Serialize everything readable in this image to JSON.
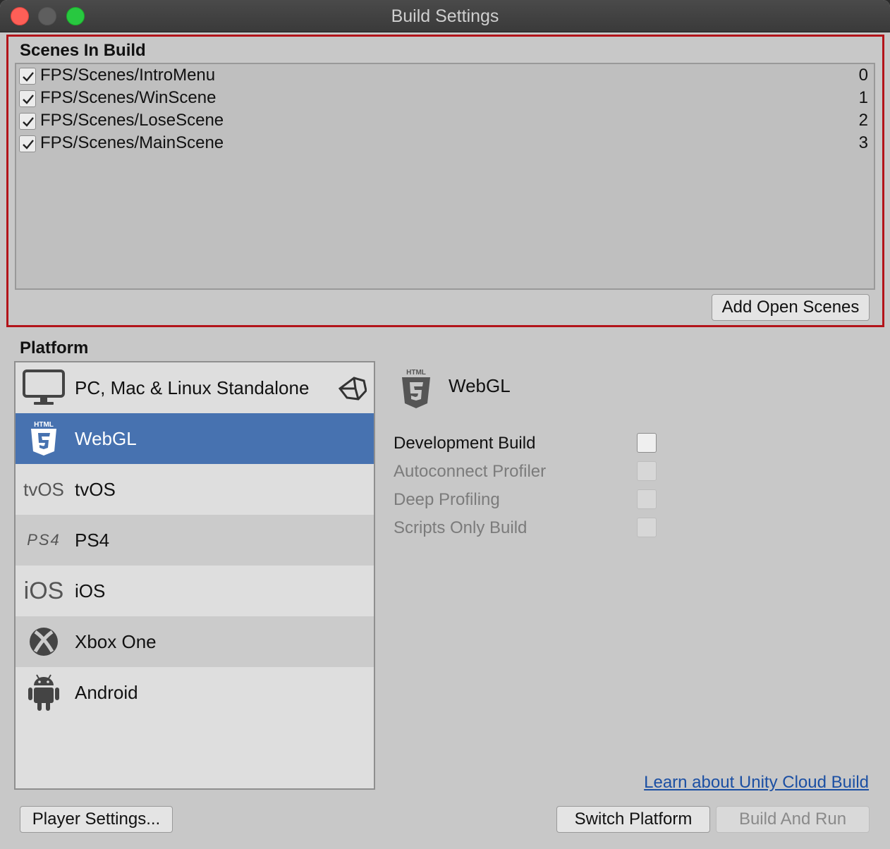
{
  "window": {
    "title": "Build Settings"
  },
  "scenes": {
    "title": "Scenes In Build",
    "items": [
      {
        "name": "FPS/Scenes/IntroMenu",
        "index": "0",
        "checked": true
      },
      {
        "name": "FPS/Scenes/WinScene",
        "index": "1",
        "checked": true
      },
      {
        "name": "FPS/Scenes/LoseScene",
        "index": "2",
        "checked": true
      },
      {
        "name": "FPS/Scenes/MainScene",
        "index": "3",
        "checked": true
      }
    ],
    "add_button": "Add Open Scenes"
  },
  "platform": {
    "title": "Platform",
    "items": [
      {
        "label": "PC, Mac & Linux Standalone",
        "icon": "monitor-icon"
      },
      {
        "label": "WebGL",
        "icon": "html5-icon",
        "selected": true
      },
      {
        "label": "tvOS",
        "icon": "tvos-icon",
        "icon_text": "tvOS"
      },
      {
        "label": "PS4",
        "icon": "ps4-icon",
        "icon_text": "PS4"
      },
      {
        "label": "iOS",
        "icon": "ios-icon",
        "icon_text": "iOS"
      },
      {
        "label": "Xbox One",
        "icon": "xbox-icon"
      },
      {
        "label": "Android",
        "icon": "android-icon"
      }
    ],
    "selected_name": "WebGL"
  },
  "options": [
    {
      "label": "Development Build",
      "enabled": true,
      "checked": false
    },
    {
      "label": "Autoconnect Profiler",
      "enabled": false,
      "checked": false
    },
    {
      "label": "Deep Profiling",
      "enabled": false,
      "checked": false
    },
    {
      "label": "Scripts Only Build",
      "enabled": false,
      "checked": false
    }
  ],
  "footer": {
    "cloud_link": "Learn about Unity Cloud Build",
    "player_settings": "Player Settings...",
    "switch_platform": "Switch Platform",
    "build_and_run": "Build And Run"
  },
  "colors": {
    "highlight_border": "#b3141a",
    "selection": "#4772b0",
    "link": "#1b4fa3"
  }
}
